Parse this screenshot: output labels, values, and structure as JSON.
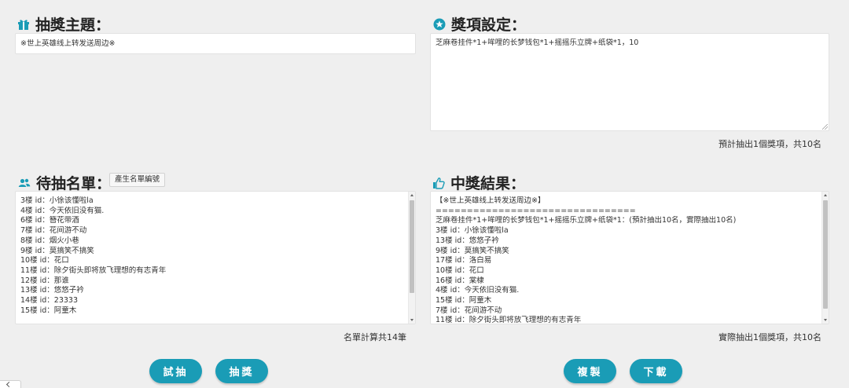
{
  "colors": {
    "accent": "#1a9cb6",
    "background": "#efefef"
  },
  "topic": {
    "icon": "gift-icon",
    "heading": "抽獎主題：",
    "value": "※世上英雄线上转发送周边※"
  },
  "prizes": {
    "icon": "star-circle-icon",
    "heading": "獎項設定：",
    "value": "芝麻卷挂件*1+哞哩的长梦钱包*1+摇摇乐立牌+纸袋*1，10",
    "summary": "預計抽出1個獎項，共10名"
  },
  "candidates": {
    "icon": "users-icon",
    "heading": "待抽名單：",
    "generate_button": "產生名單編號",
    "lines": [
      "3楼  id：小徐该懂啦la",
      "4楼  id：今天依旧没有猫.",
      "6楼  id：簪花带酒",
      "7楼  id：花间游不动",
      "8楼  id：烟火小巷",
      "9楼  id：莫搞笑不搞笑",
      "10楼  id：花口",
      "11楼  id：除夕街头即将放飞理想的有志青年",
      "12楼  id：那谁",
      "13楼  id：悠悠子衿",
      "14楼  id：23333",
      "15楼  id：阿童木"
    ],
    "summary": "名單計算共14筆"
  },
  "results": {
    "icon": "thumbs-up-icon",
    "heading": "中獎結果：",
    "lines": [
      "【※世上英雄线上转发送周边※】",
      "================================",
      "芝麻卷挂件*1+哞哩的长梦钱包*1+摇摇乐立牌+纸袋*1：(預計抽出10名，實際抽出10名)",
      "3楼  id：小徐该懂啦la",
      "13楼  id：悠悠子衿",
      "9楼  id：莫搞笑不搞笑",
      "17楼  id：洛白易",
      "10楼  id：花口",
      "16楼  id：棠棣",
      "4楼  id：今天依旧没有猫.",
      "15楼  id：阿童木",
      "7楼  id：花间游不动",
      "11楼  id：除夕街头即将放飞理想的有志青年"
    ],
    "summary": "實際抽出1個獎項，共10名"
  },
  "actions": {
    "trial": "試抽",
    "draw": "抽獎",
    "copy": "複製",
    "download": "下載"
  }
}
